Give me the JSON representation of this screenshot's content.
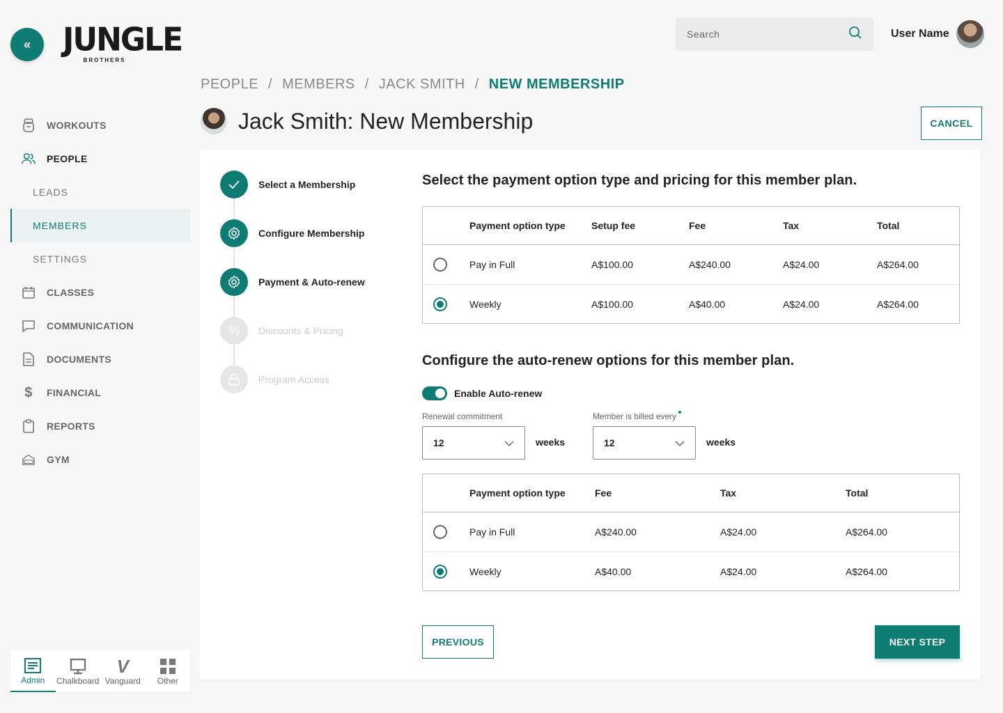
{
  "app": {
    "logo_text": "JUNGLE",
    "logo_sub": "BROTHERS"
  },
  "sidebar": {
    "items": [
      {
        "label": "WORKOUTS",
        "icon": "kettlebell-icon"
      },
      {
        "label": "PEOPLE",
        "icon": "people-icon"
      },
      {
        "label": "LEADS"
      },
      {
        "label": "MEMBERS"
      },
      {
        "label": "SETTINGS"
      },
      {
        "label": "CLASSES",
        "icon": "calendar-icon"
      },
      {
        "label": "COMMUNICATION",
        "icon": "chat-icon"
      },
      {
        "label": "DOCUMENTS",
        "icon": "document-icon"
      },
      {
        "label": "FINANCIAL",
        "icon": "dollar-icon"
      },
      {
        "label": "REPORTS",
        "icon": "clipboard-icon"
      },
      {
        "label": "GYM",
        "icon": "gym-icon"
      }
    ],
    "switcher": [
      {
        "label": "Admin",
        "icon": "admin-icon"
      },
      {
        "label": "Chalkboard",
        "icon": "monitor-icon"
      },
      {
        "label": "Vanguard",
        "icon": "vanguard-icon"
      },
      {
        "label": "Other",
        "icon": "grid-icon"
      }
    ]
  },
  "header": {
    "search_placeholder": "Search",
    "user_name": "User Name"
  },
  "breadcrumb": [
    "PEOPLE",
    "MEMBERS",
    "JACK SMITH",
    "NEW MEMBERSHIP"
  ],
  "page": {
    "title": "Jack Smith: New Membership",
    "cancel_label": "CANCEL"
  },
  "steps": [
    {
      "label": "Select a Membership",
      "state": "done"
    },
    {
      "label": "Configure Membership",
      "state": "active"
    },
    {
      "label": "Payment & Auto-renew",
      "state": "active"
    },
    {
      "label": "Discounts & Pricing",
      "state": "disabled"
    },
    {
      "label": "Program Access",
      "state": "disabled"
    }
  ],
  "payment": {
    "title": "Select the payment option type and pricing for this member plan.",
    "headers": [
      "Payment option type",
      "Setup fee",
      "Fee",
      "Tax",
      "Total"
    ],
    "rows": [
      {
        "type": "Pay in Full",
        "setup": "A$100.00",
        "fee": "A$240.00",
        "tax": "A$24.00",
        "total": "A$264.00",
        "selected": false
      },
      {
        "type": "Weekly",
        "setup": "A$100.00",
        "fee": "A$40.00",
        "tax": "A$24.00",
        "total": "A$264.00",
        "selected": true
      }
    ]
  },
  "autorenew": {
    "title": "Configure the auto-renew options for this member plan.",
    "toggle_label": "Enable Auto-renew",
    "toggle_on": true,
    "commitment_label": "Renewal commitment",
    "commitment_value": "12",
    "commitment_unit": "weeks",
    "billed_label": "Member is billed every",
    "billed_value": "12",
    "billed_unit": "weeks",
    "headers": [
      "Payment option type",
      "Fee",
      "Tax",
      "Total"
    ],
    "rows": [
      {
        "type": "Pay in Full",
        "fee": "A$240.00",
        "tax": "A$24.00",
        "total": "A$264.00",
        "selected": false
      },
      {
        "type": "Weekly",
        "fee": "A$40.00",
        "tax": "A$24.00",
        "total": "A$264.00",
        "selected": true
      }
    ]
  },
  "actions": {
    "previous": "PREVIOUS",
    "next": "NEXT STEP"
  },
  "colors": {
    "accent": "#0e7c73"
  }
}
